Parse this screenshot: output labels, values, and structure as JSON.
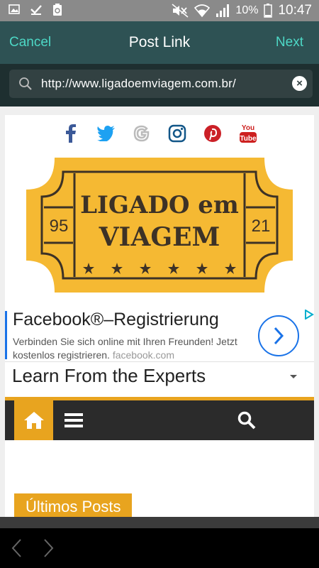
{
  "status_bar": {
    "battery": "10%",
    "time": "10:47"
  },
  "header": {
    "cancel_label": "Cancel",
    "title": "Post Link",
    "next_label": "Next"
  },
  "url_bar": {
    "value": "http://www.ligadoemviagem.com.br/",
    "clear_icon": "×"
  },
  "site": {
    "social_icons": [
      "facebook-icon",
      "twitter-icon",
      "google-icon",
      "instagram-icon",
      "pinterest-icon",
      "youtube-icon"
    ],
    "logo": {
      "line1": "LIGADO em",
      "line2": "VIAGEM",
      "left_num": "95",
      "right_num": "21"
    },
    "ad": {
      "title": "Facebook®–Registrierung",
      "desc": "Verbinden Sie sich online mit Ihren Freunden! Jetzt kostenlos registrieren.",
      "source": "facebook.com"
    },
    "learn_label": "Learn From the Experts",
    "posts_label": "Últimos Posts"
  },
  "colors": {
    "accent": "#4dd8c6",
    "header": "#2e5254",
    "gold": "#e8a41f"
  }
}
